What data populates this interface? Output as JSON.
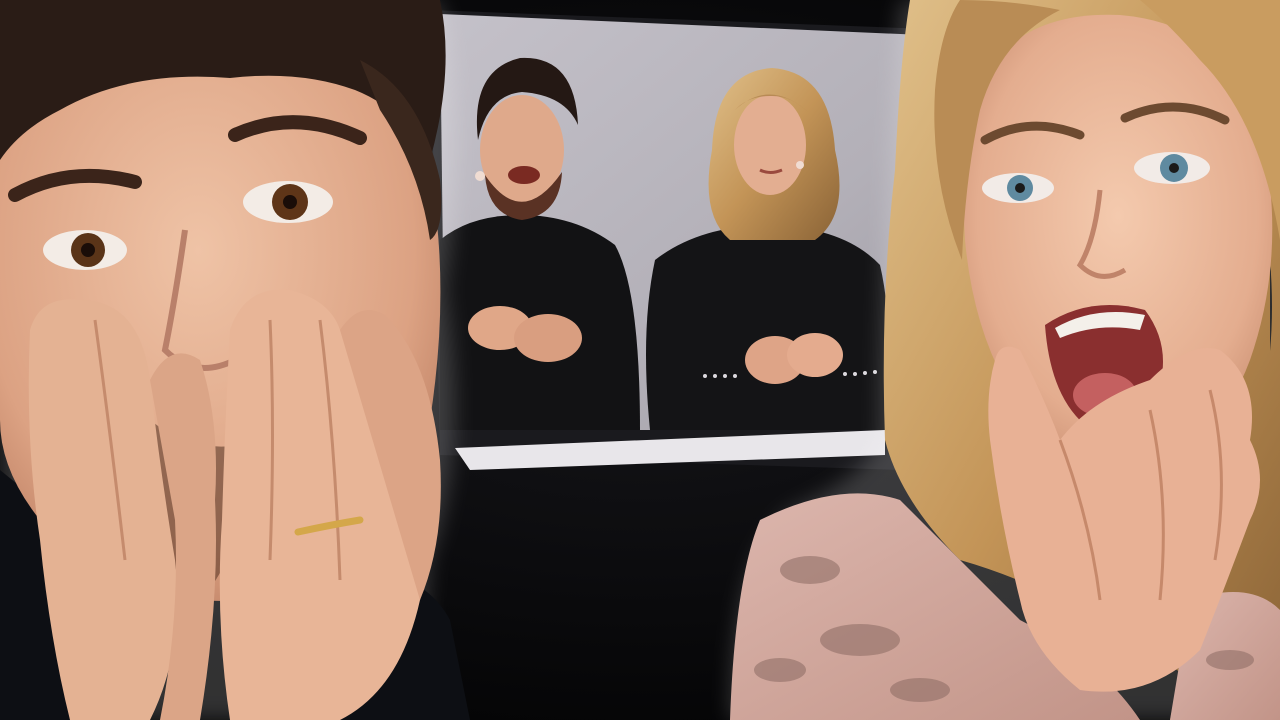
{
  "image": {
    "kind": "reaction-thumbnail",
    "colors": {
      "background": "#070709",
      "backdrop": "#b7b4bc",
      "screen_frame": "#1a1a1e",
      "clothing_dark": "#141416",
      "skin": "#e2aa8c",
      "hair_dark": "#2a1c16",
      "hair_blonde": "#c79b5f",
      "blouse": "#d2aaa1"
    }
  }
}
